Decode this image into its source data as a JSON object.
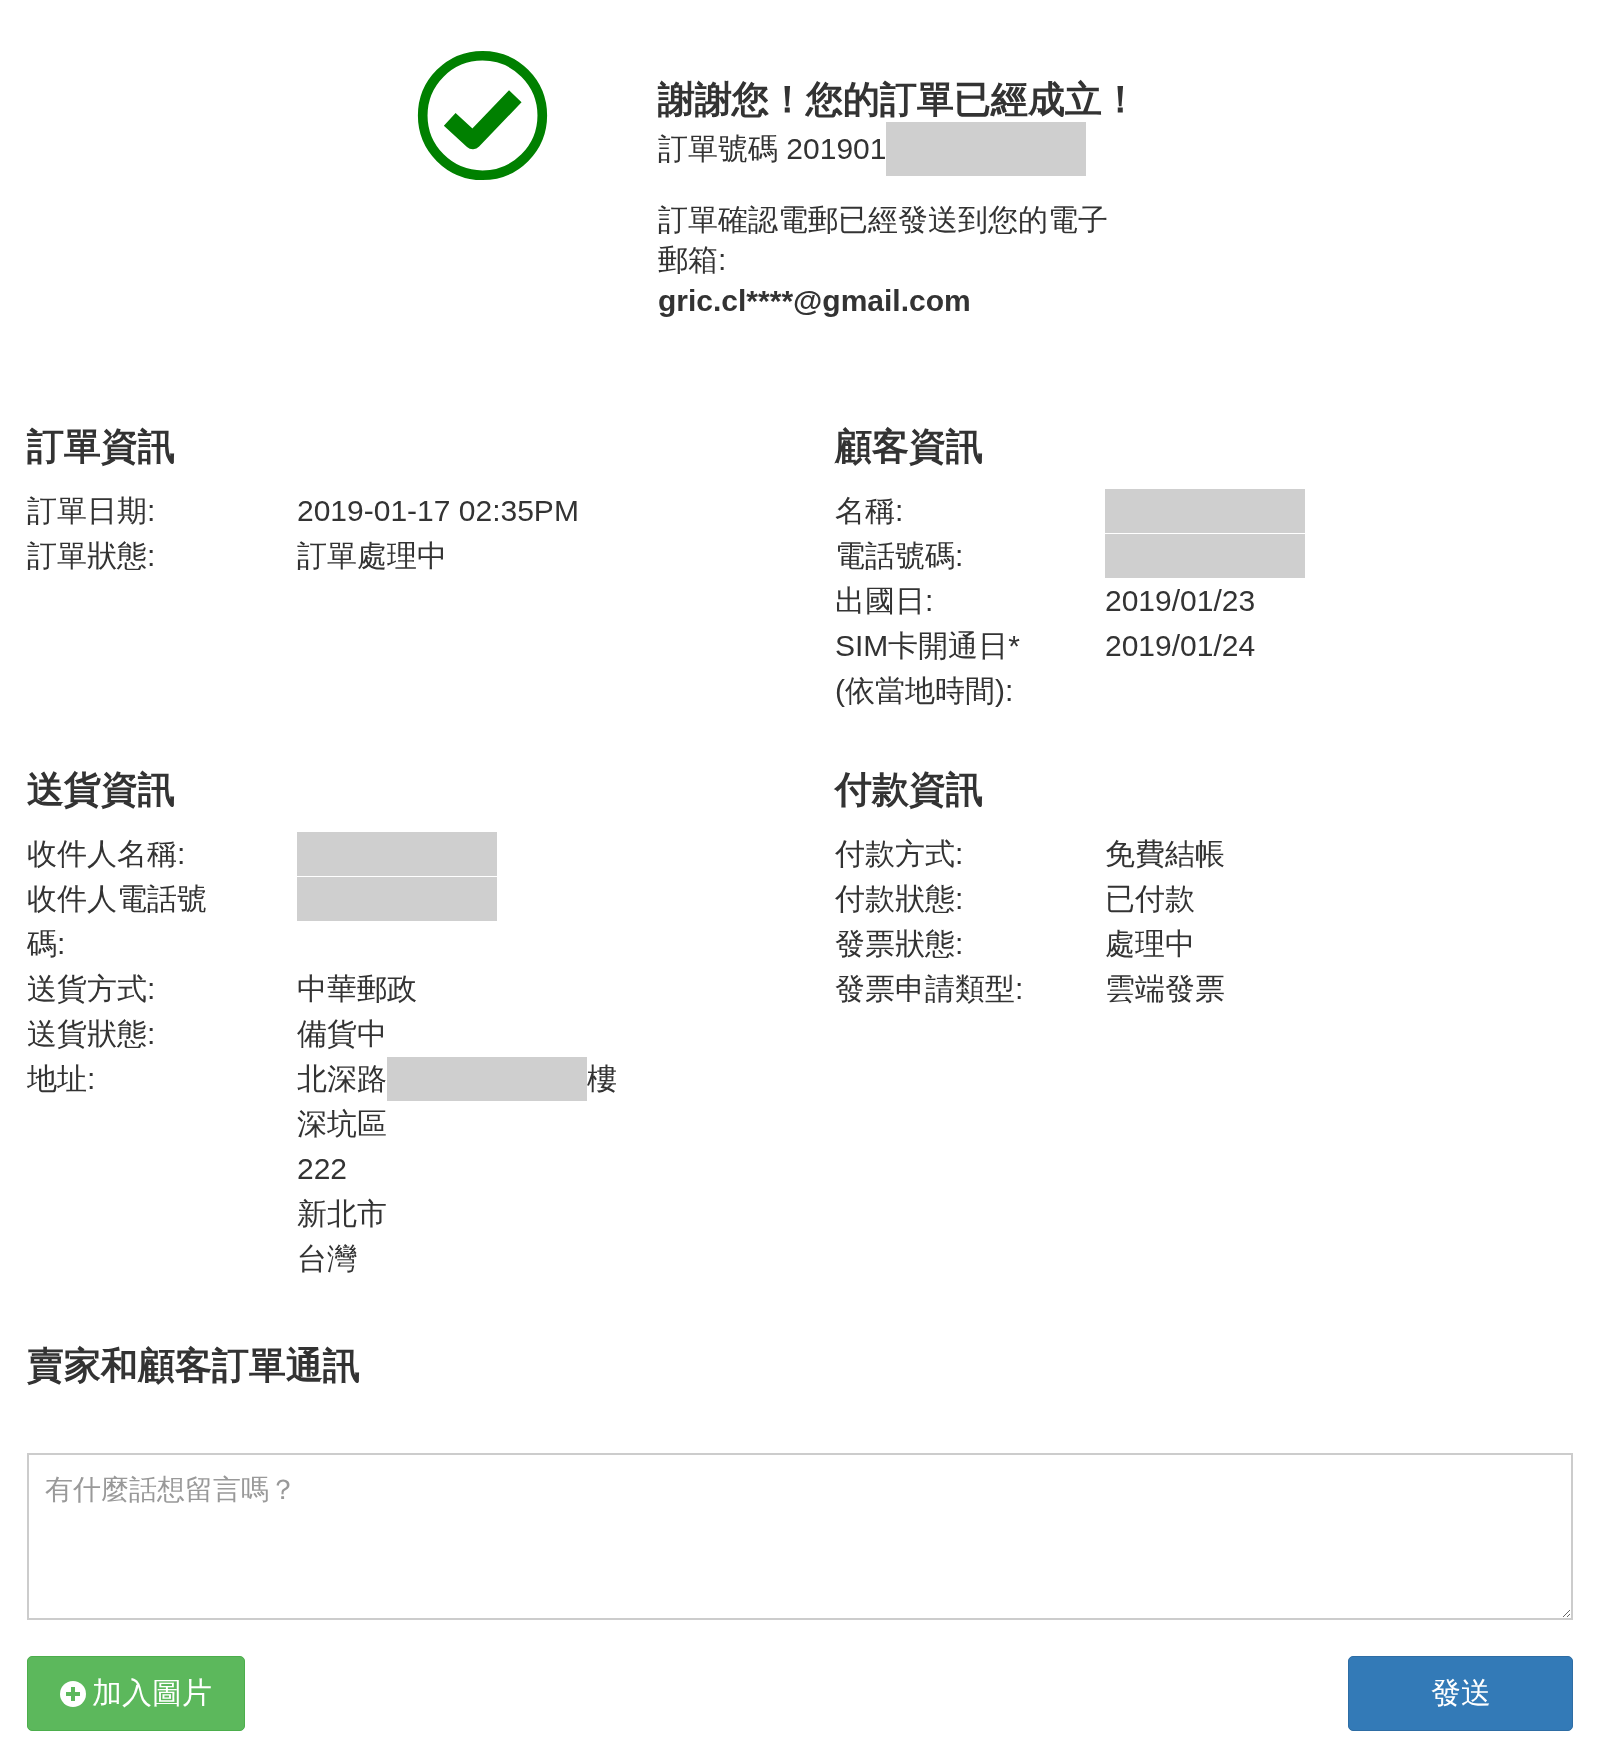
{
  "confirmation": {
    "title": "謝謝您！您的訂單已經成立！",
    "order_number": {
      "text": "訂單號碼 201901",
      "redacted": true
    },
    "email_notice": "訂單確認電郵已經發送到您的電子郵箱:",
    "email": "gric.cl****@gmail.com"
  },
  "sections": [
    {
      "title": "訂單資訊",
      "rows": [
        {
          "label": "訂單日期:",
          "value": "2019-01-17 02:35PM"
        },
        {
          "label": "訂單狀態:",
          "value": "訂單處理中"
        }
      ]
    },
    {
      "title": "顧客資訊",
      "rows": [
        {
          "label": "名稱:",
          "redacted": true
        },
        {
          "label": "電話號碼:",
          "redacted": true
        },
        {
          "label": "出國日:",
          "value": "2019/01/23"
        },
        {
          "label": "SIM卡開通日* (依當地時間):",
          "value": "2019/01/24"
        }
      ]
    },
    {
      "title": "送貨資訊",
      "rows": [
        {
          "label": "收件人名稱:",
          "redacted": true
        },
        {
          "label": "收件人電話號碼:",
          "redacted": true
        },
        {
          "label": "送貨方式:",
          "value": "中華郵政"
        },
        {
          "label": "送貨狀態:",
          "value": "備貨中"
        },
        {
          "label": "地址:",
          "value": "北深路",
          "redacted": true,
          "suffix": "樓",
          "extra_lines": [
            "深坑區",
            "222",
            "新北市",
            "台灣"
          ]
        }
      ]
    },
    {
      "title": "付款資訊",
      "rows": [
        {
          "label": "付款方式:",
          "value": "免費結帳"
        },
        {
          "label": "付款狀態:",
          "value": "已付款"
        },
        {
          "label": "發票狀態:",
          "value": "處理中"
        },
        {
          "label": "發票申請類型:",
          "value": "雲端發票"
        }
      ]
    }
  ],
  "messages": {
    "title": "賣家和顧客訂單通訊",
    "placeholder": "有什麼話想留言嗎？",
    "add_image_button": "加入圖片",
    "send_button": "發送"
  }
}
